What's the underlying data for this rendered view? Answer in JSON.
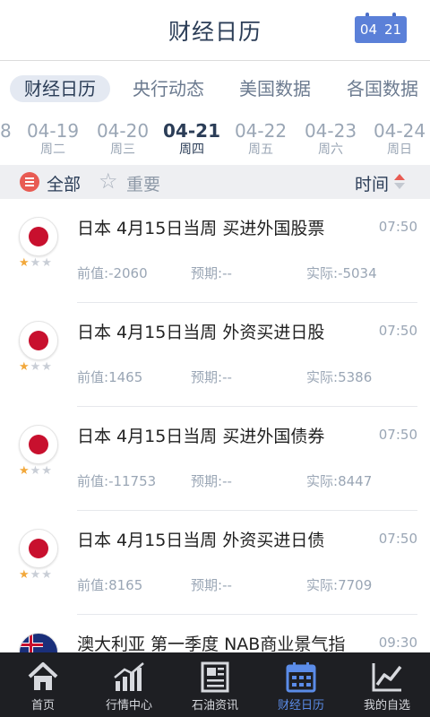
{
  "header": {
    "title": "财经日历",
    "calendar_icon": "calendar-icon",
    "calendar_month": "04",
    "calendar_day": "21"
  },
  "tabs": [
    {
      "label": "财经日历",
      "active": true
    },
    {
      "label": "央行动态",
      "active": false
    },
    {
      "label": "美国数据",
      "active": false
    },
    {
      "label": "各国数据",
      "active": false
    }
  ],
  "dates": {
    "partial_prev": "8",
    "items": [
      {
        "date": "04-19",
        "weekday": "周二"
      },
      {
        "date": "04-20",
        "weekday": "周三"
      },
      {
        "date": "04-21",
        "weekday": "周四",
        "active": true
      },
      {
        "date": "04-22",
        "weekday": "周五"
      },
      {
        "date": "04-23",
        "weekday": "周六"
      },
      {
        "date": "04-24",
        "weekday": "周日"
      }
    ]
  },
  "filter": {
    "all_label": "全部",
    "important_label": "重要",
    "time_label": "时间"
  },
  "events": [
    {
      "country": "japan",
      "importance": 1,
      "name": "日本 4月15日当周 买进外国股票",
      "time": "07:50",
      "prev_label": "前值:",
      "prev": "-2060",
      "forecast_label": "预期:",
      "forecast": "--",
      "actual_label": "实际:",
      "actual": "-5034"
    },
    {
      "country": "japan",
      "importance": 1,
      "name": "日本 4月15日当周 外资买进日股",
      "time": "07:50",
      "prev_label": "前值:",
      "prev": "1465",
      "forecast_label": "预期:",
      "forecast": "--",
      "actual_label": "实际:",
      "actual": "5386"
    },
    {
      "country": "japan",
      "importance": 1,
      "name": "日本 4月15日当周 买进外国债券",
      "time": "07:50",
      "prev_label": "前值:",
      "prev": "-11753",
      "forecast_label": "预期:",
      "forecast": "--",
      "actual_label": "实际:",
      "actual": "8447"
    },
    {
      "country": "japan",
      "importance": 1,
      "name": "日本 4月15日当周 外资买进日债",
      "time": "07:50",
      "prev_label": "前值:",
      "prev": "8165",
      "forecast_label": "预期:",
      "forecast": "--",
      "actual_label": "实际:",
      "actual": "7709"
    },
    {
      "country": "australia",
      "importance": 1,
      "name": "澳大利亚 第一季度 NAB商业景气指",
      "time": "09:30",
      "prev_label": "前值:",
      "prev": "",
      "forecast_label": "预期:",
      "forecast": "",
      "actual_label": "实际:",
      "actual": ""
    }
  ],
  "tabbar": [
    {
      "label": "首页",
      "icon": "home-icon"
    },
    {
      "label": "行情中心",
      "icon": "market-chart-icon"
    },
    {
      "label": "石油资讯",
      "icon": "newspaper-icon"
    },
    {
      "label": "财经日历",
      "icon": "calendar-icon",
      "active": true
    },
    {
      "label": "我的自选",
      "icon": "trend-line-icon"
    }
  ],
  "colors": {
    "accent": "#5b8ce8",
    "title": "#2b3d57",
    "muted": "#9aa6b5",
    "star": "#f2a83b",
    "alert": "#e85b53",
    "tabbar_bg": "#1e1f23"
  }
}
